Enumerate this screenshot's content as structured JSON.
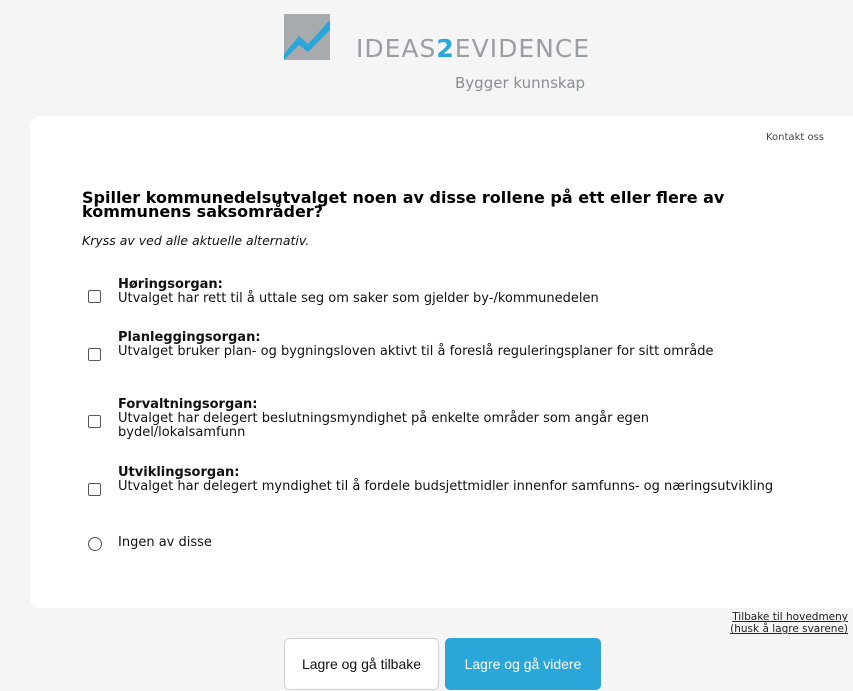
{
  "header": {
    "brand_prefix": "IDEAS",
    "brand_number": "2",
    "brand_suffix": "EVIDENCE",
    "tagline": "Bygger kunnskap",
    "logo_icon": "rising-chart-logo-icon"
  },
  "contact_label": "Kontakt oss",
  "question": {
    "title": "Spiller kommunedelsutvalget noen av disse rollene på ett eller flere av kommunens saksområder?",
    "instruction": "Kryss av ved alle aktuelle alternativ."
  },
  "options": [
    {
      "title": "Høringsorgan:",
      "desc": "Utvalget har rett til å uttale seg om saker som gjelder by-/kommunedelen",
      "checked": false
    },
    {
      "title": "Planleggingsorgan:",
      "desc": "Utvalget bruker plan- og bygningsloven aktivt til å foreslå reguleringsplaner for sitt område",
      "checked": false
    },
    {
      "title": "Forvaltningsorgan:",
      "desc": "Utvalget har delegert beslutningsmyndighet på enkelte områder som angår egen bydel/lokalsamfunn",
      "checked": false
    },
    {
      "title": "Utviklingsorgan:",
      "desc": "Utvalget har delegert myndighet til å fordele budsjettmidler innenfor samfunns- og næringsutvikling",
      "checked": false
    }
  ],
  "none_option": {
    "label": "Ingen av disse",
    "selected": false
  },
  "footer": {
    "back_to_menu_line1": "Tilbake til hovedmeny",
    "back_to_menu_line2": "(husk å lagre svarene)",
    "save_back_label": "Lagre og gå tilbake",
    "save_next_label": "Lagre og gå videre"
  },
  "colors": {
    "accent": "#2aa6d8",
    "background": "#f5f5f5",
    "card": "#ffffff",
    "logo_grey": "#9a9ea2"
  }
}
